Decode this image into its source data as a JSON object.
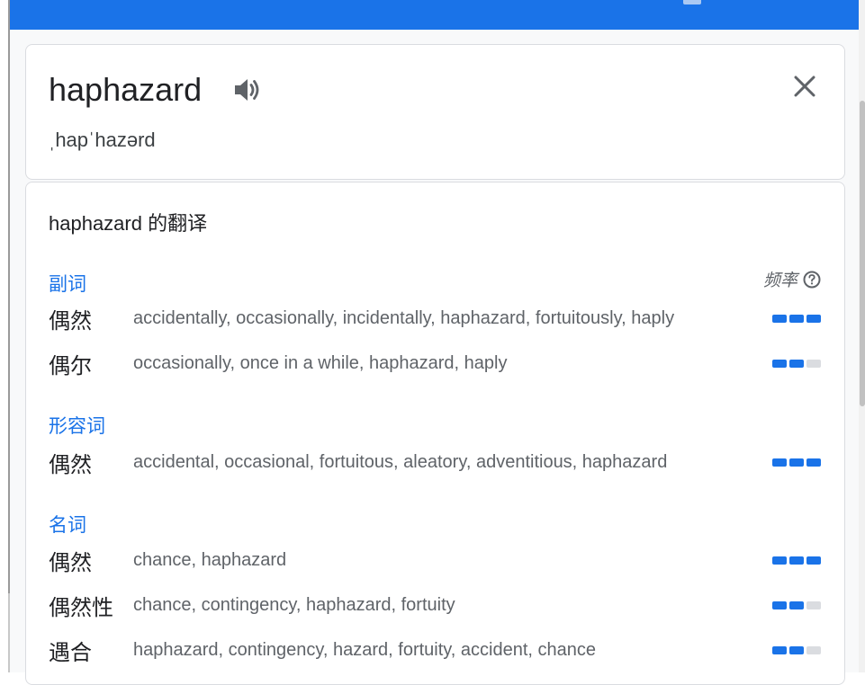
{
  "header": {
    "word": "haphazard",
    "phonetic": "ˌhapˈhazərd"
  },
  "translations": {
    "title": "haphazard 的翻译",
    "frequency_label": "频率",
    "groups": [
      {
        "pos": "副词",
        "rows": [
          {
            "zh": "偶然",
            "en": "accidentally, occasionally, incidentally, haphazard, fortuitously, haply",
            "frequency": 3
          },
          {
            "zh": "偶尔",
            "en": "occasionally, once in a while, haphazard, haply",
            "frequency": 2
          }
        ]
      },
      {
        "pos": "形容词",
        "rows": [
          {
            "zh": "偶然",
            "en": "accidental, occasional, fortuitous, aleatory, adventitious, haphazard",
            "frequency": 3
          }
        ]
      },
      {
        "pos": "名词",
        "rows": [
          {
            "zh": "偶然",
            "en": "chance, haphazard",
            "frequency": 3
          },
          {
            "zh": "偶然性",
            "en": "chance, contingency, haphazard, fortuity",
            "frequency": 2
          },
          {
            "zh": "遇合",
            "en": "haphazard, contingency, hazard, fortuity, accident, chance",
            "frequency": 2
          }
        ]
      }
    ]
  },
  "colors": {
    "accent": "#1a73e8",
    "bar_off": "#dadce0"
  }
}
